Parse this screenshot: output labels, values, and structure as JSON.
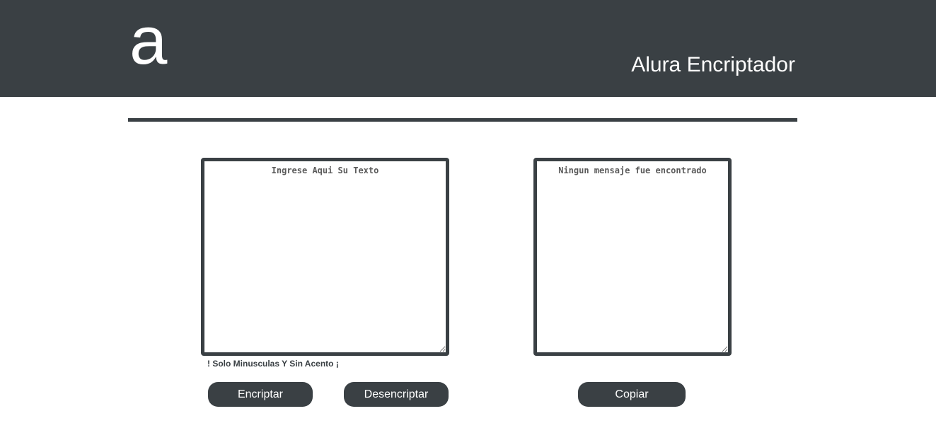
{
  "header": {
    "logo_text": "a",
    "title": "Alura Encriptador"
  },
  "input": {
    "placeholder": "Ingrese Aqui Su Texto",
    "value": ""
  },
  "output": {
    "placeholder": "Ningun mensaje fue encontrado",
    "value": ""
  },
  "hint": "! Solo Minusculas Y Sin Acento ¡",
  "buttons": {
    "encrypt_label": "Encriptar",
    "decrypt_label": "Desencriptar",
    "copy_label": "Copiar"
  },
  "colors": {
    "dark": "#3a4044",
    "background": "#ffffff",
    "text_on_dark": "#ffffff"
  }
}
